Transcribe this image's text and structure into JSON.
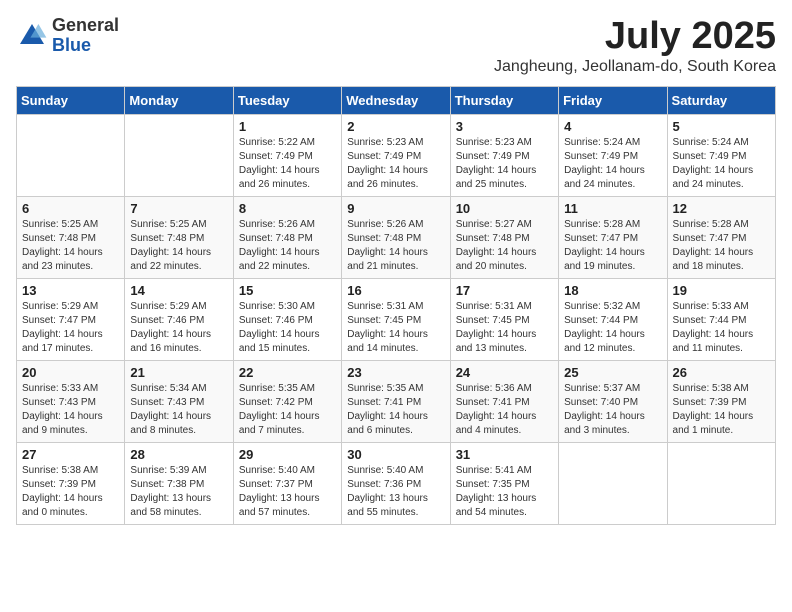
{
  "logo": {
    "general": "General",
    "blue": "Blue"
  },
  "title": {
    "month": "July 2025",
    "location": "Jangheung, Jeollanam-do, South Korea"
  },
  "days_of_week": [
    "Sunday",
    "Monday",
    "Tuesday",
    "Wednesday",
    "Thursday",
    "Friday",
    "Saturday"
  ],
  "weeks": [
    [
      {
        "day": "",
        "info": ""
      },
      {
        "day": "",
        "info": ""
      },
      {
        "day": "1",
        "info": "Sunrise: 5:22 AM\nSunset: 7:49 PM\nDaylight: 14 hours and 26 minutes."
      },
      {
        "day": "2",
        "info": "Sunrise: 5:23 AM\nSunset: 7:49 PM\nDaylight: 14 hours and 26 minutes."
      },
      {
        "day": "3",
        "info": "Sunrise: 5:23 AM\nSunset: 7:49 PM\nDaylight: 14 hours and 25 minutes."
      },
      {
        "day": "4",
        "info": "Sunrise: 5:24 AM\nSunset: 7:49 PM\nDaylight: 14 hours and 24 minutes."
      },
      {
        "day": "5",
        "info": "Sunrise: 5:24 AM\nSunset: 7:49 PM\nDaylight: 14 hours and 24 minutes."
      }
    ],
    [
      {
        "day": "6",
        "info": "Sunrise: 5:25 AM\nSunset: 7:48 PM\nDaylight: 14 hours and 23 minutes."
      },
      {
        "day": "7",
        "info": "Sunrise: 5:25 AM\nSunset: 7:48 PM\nDaylight: 14 hours and 22 minutes."
      },
      {
        "day": "8",
        "info": "Sunrise: 5:26 AM\nSunset: 7:48 PM\nDaylight: 14 hours and 22 minutes."
      },
      {
        "day": "9",
        "info": "Sunrise: 5:26 AM\nSunset: 7:48 PM\nDaylight: 14 hours and 21 minutes."
      },
      {
        "day": "10",
        "info": "Sunrise: 5:27 AM\nSunset: 7:48 PM\nDaylight: 14 hours and 20 minutes."
      },
      {
        "day": "11",
        "info": "Sunrise: 5:28 AM\nSunset: 7:47 PM\nDaylight: 14 hours and 19 minutes."
      },
      {
        "day": "12",
        "info": "Sunrise: 5:28 AM\nSunset: 7:47 PM\nDaylight: 14 hours and 18 minutes."
      }
    ],
    [
      {
        "day": "13",
        "info": "Sunrise: 5:29 AM\nSunset: 7:47 PM\nDaylight: 14 hours and 17 minutes."
      },
      {
        "day": "14",
        "info": "Sunrise: 5:29 AM\nSunset: 7:46 PM\nDaylight: 14 hours and 16 minutes."
      },
      {
        "day": "15",
        "info": "Sunrise: 5:30 AM\nSunset: 7:46 PM\nDaylight: 14 hours and 15 minutes."
      },
      {
        "day": "16",
        "info": "Sunrise: 5:31 AM\nSunset: 7:45 PM\nDaylight: 14 hours and 14 minutes."
      },
      {
        "day": "17",
        "info": "Sunrise: 5:31 AM\nSunset: 7:45 PM\nDaylight: 14 hours and 13 minutes."
      },
      {
        "day": "18",
        "info": "Sunrise: 5:32 AM\nSunset: 7:44 PM\nDaylight: 14 hours and 12 minutes."
      },
      {
        "day": "19",
        "info": "Sunrise: 5:33 AM\nSunset: 7:44 PM\nDaylight: 14 hours and 11 minutes."
      }
    ],
    [
      {
        "day": "20",
        "info": "Sunrise: 5:33 AM\nSunset: 7:43 PM\nDaylight: 14 hours and 9 minutes."
      },
      {
        "day": "21",
        "info": "Sunrise: 5:34 AM\nSunset: 7:43 PM\nDaylight: 14 hours and 8 minutes."
      },
      {
        "day": "22",
        "info": "Sunrise: 5:35 AM\nSunset: 7:42 PM\nDaylight: 14 hours and 7 minutes."
      },
      {
        "day": "23",
        "info": "Sunrise: 5:35 AM\nSunset: 7:41 PM\nDaylight: 14 hours and 6 minutes."
      },
      {
        "day": "24",
        "info": "Sunrise: 5:36 AM\nSunset: 7:41 PM\nDaylight: 14 hours and 4 minutes."
      },
      {
        "day": "25",
        "info": "Sunrise: 5:37 AM\nSunset: 7:40 PM\nDaylight: 14 hours and 3 minutes."
      },
      {
        "day": "26",
        "info": "Sunrise: 5:38 AM\nSunset: 7:39 PM\nDaylight: 14 hours and 1 minute."
      }
    ],
    [
      {
        "day": "27",
        "info": "Sunrise: 5:38 AM\nSunset: 7:39 PM\nDaylight: 14 hours and 0 minutes."
      },
      {
        "day": "28",
        "info": "Sunrise: 5:39 AM\nSunset: 7:38 PM\nDaylight: 13 hours and 58 minutes."
      },
      {
        "day": "29",
        "info": "Sunrise: 5:40 AM\nSunset: 7:37 PM\nDaylight: 13 hours and 57 minutes."
      },
      {
        "day": "30",
        "info": "Sunrise: 5:40 AM\nSunset: 7:36 PM\nDaylight: 13 hours and 55 minutes."
      },
      {
        "day": "31",
        "info": "Sunrise: 5:41 AM\nSunset: 7:35 PM\nDaylight: 13 hours and 54 minutes."
      },
      {
        "day": "",
        "info": ""
      },
      {
        "day": "",
        "info": ""
      }
    ]
  ]
}
